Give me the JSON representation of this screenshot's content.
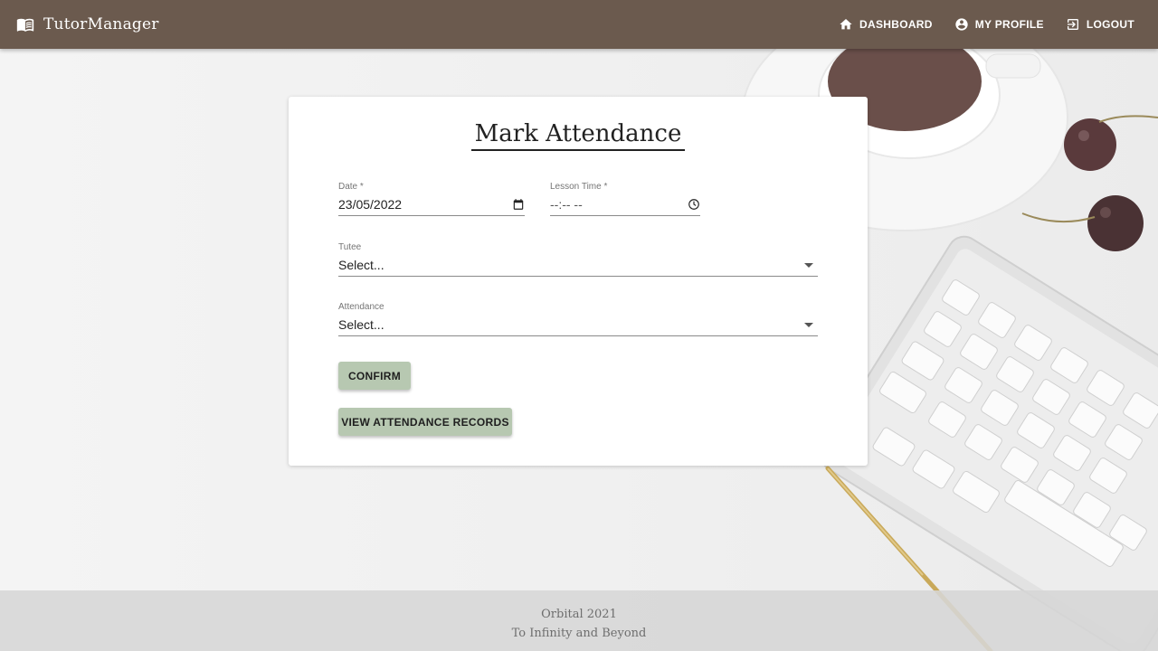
{
  "app": {
    "name": "TutorManager",
    "icon": "book-open-icon"
  },
  "nav": [
    {
      "label": "DASHBOARD",
      "icon": "home-icon"
    },
    {
      "label": "MY PROFILE",
      "icon": "account-circle-icon"
    },
    {
      "label": "LOGOUT",
      "icon": "logout-icon"
    }
  ],
  "form": {
    "title": "Mark Attendance",
    "date": {
      "label": "Date *",
      "value": "23/05/2022",
      "icon": "calendar-icon"
    },
    "lesson_time": {
      "label": "Lesson Time *",
      "value": "--:-- --",
      "icon": "clock-icon"
    },
    "tutee": {
      "label": "Tutee",
      "value": "Select..."
    },
    "attendance": {
      "label": "Attendance",
      "value": "Select..."
    },
    "confirm_label": "CONFIRM",
    "view_records_label": "VIEW ATTENDANCE RECORDS"
  },
  "footer": {
    "line1": "Orbital 2021",
    "line2": "To Infinity and Beyond"
  },
  "colors": {
    "appbar": "#6b5a4e",
    "button": "#b7c8b1",
    "card": "#ffffff",
    "footer": "#d6d6d6"
  }
}
